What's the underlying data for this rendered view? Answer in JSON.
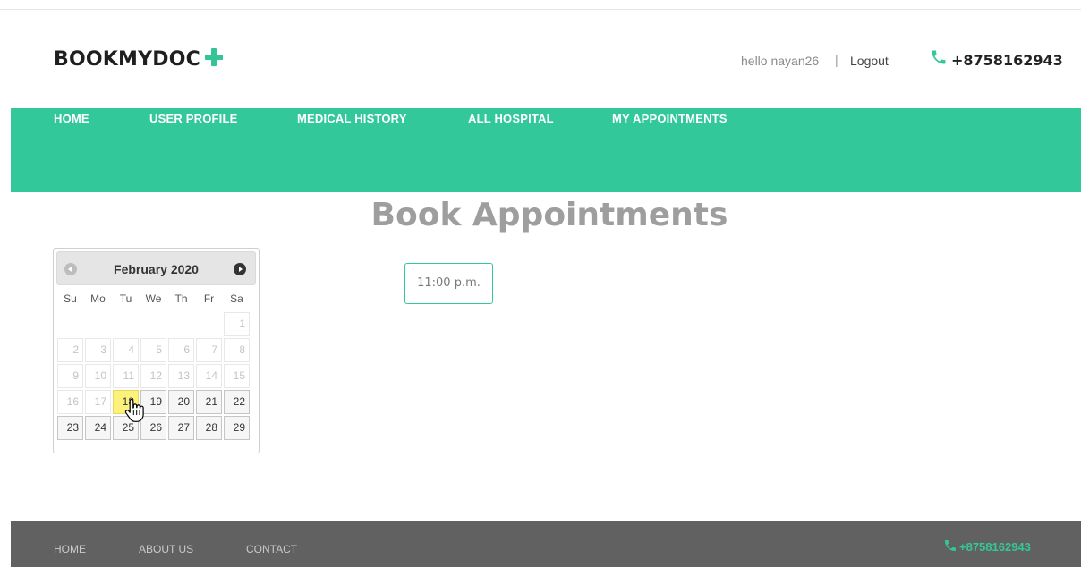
{
  "header": {
    "logo_text": "BOOKMYDOC",
    "greeting": "hello nayan26",
    "separator": "|",
    "logout_label": "Logout",
    "phone": "+8758162943",
    "accent_color": "#33c899"
  },
  "nav": {
    "items": [
      {
        "label": "HOME"
      },
      {
        "label": "USER PROFILE"
      },
      {
        "label": "MEDICAL HISTORY"
      },
      {
        "label": "ALL HOSPITAL"
      },
      {
        "label": "MY APPOINTMENTS"
      }
    ]
  },
  "main": {
    "title": "Book Appointments",
    "time_slot": "11:00 p.m."
  },
  "calendar": {
    "month_label": "February 2020",
    "weekdays": [
      "Su",
      "Mo",
      "Tu",
      "We",
      "Th",
      "Fr",
      "Sa"
    ],
    "weeks": [
      [
        "",
        "",
        "",
        "",
        "",
        "",
        "1"
      ],
      [
        "2",
        "3",
        "4",
        "5",
        "6",
        "7",
        "8"
      ],
      [
        "9",
        "10",
        "11",
        "12",
        "13",
        "14",
        "15"
      ],
      [
        "16",
        "17",
        "18",
        "19",
        "20",
        "21",
        "22"
      ],
      [
        "23",
        "24",
        "25",
        "26",
        "27",
        "28",
        "29"
      ]
    ],
    "first_selectable_day": 18,
    "highlighted_day": 18
  },
  "footer": {
    "links": [
      {
        "label": "HOME"
      },
      {
        "label": "ABOUT US"
      },
      {
        "label": "CONTACT"
      }
    ],
    "phone": "+8758162943"
  }
}
